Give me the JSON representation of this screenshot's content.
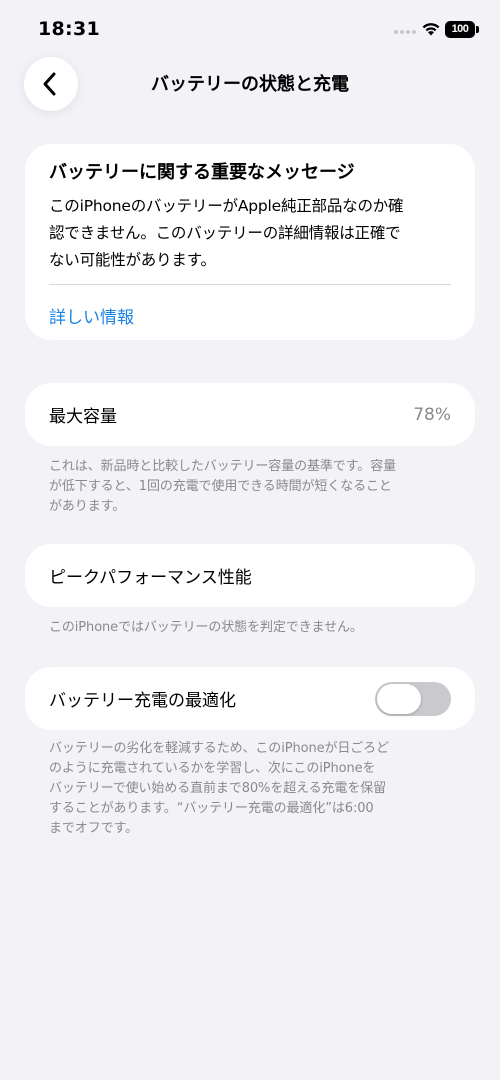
{
  "status_bar": {
    "time": "18:31",
    "battery_level": "100",
    "icons": [
      "signal-dots-icon",
      "wifi-icon",
      "battery-icon"
    ]
  },
  "nav": {
    "back_icon": "chevron-left-icon",
    "title": "バッテリーの状態と充電"
  },
  "message": {
    "title": "バッテリーに関する重要なメッセージ",
    "lines": [
      "このiPhoneのバッテリーがApple純正部品なのか確",
      "認できません。このバッテリーの詳細情報は正確で",
      "ない可能性があります。"
    ],
    "link": "詳しい情報"
  },
  "max_capacity": {
    "label": "最大容量",
    "value": "78%",
    "footnote_lines": [
      "これは、新品時と比較したバッテリー容量の基準です。容量",
      "が低下すると、1回の充電で使用できる時間が短くなること",
      "があります。"
    ]
  },
  "peak_performance": {
    "label": "ピークパフォーマンス性能",
    "footnote": "このiPhoneではバッテリーの状態を判定できません。"
  },
  "optimized_charging": {
    "label": "バッテリー充電の最適化",
    "enabled": false,
    "footnote_lines": [
      "バッテリーの劣化を軽減するため、このiPhoneが日ごろど",
      "のように充電されているかを学習し、次にこのiPhoneを",
      "バッテリーで使い始める直前まで80%を超える充電を保留",
      "することがあります。“バッテリー充電の最適化”は6:00",
      "までオフです。"
    ]
  },
  "colors": {
    "background": "#f2f2f7",
    "card": "#ffffff",
    "link": "#1a84e6",
    "secondary_text": "#8a8a8e",
    "toggle_off": "#c9c9ce"
  }
}
